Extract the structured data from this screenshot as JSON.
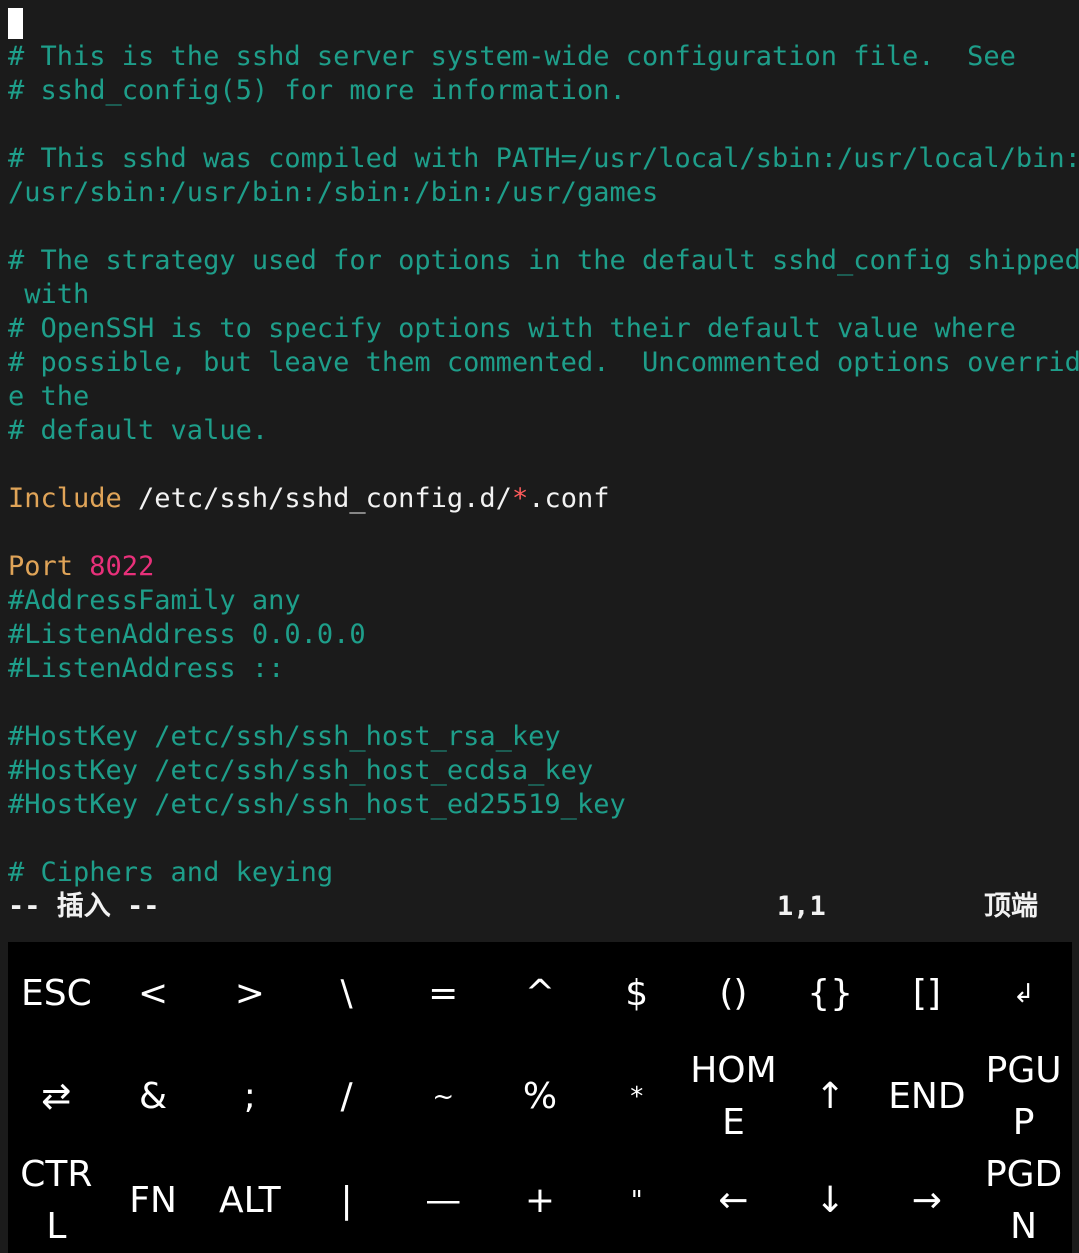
{
  "editor": {
    "lines": [
      [],
      [
        {
          "t": "# This is the sshd server system-wide configuration file.  See",
          "c": "comment"
        }
      ],
      [
        {
          "t": "# sshd_config(5) for more information.",
          "c": "comment"
        }
      ],
      [],
      [
        {
          "t": "# This sshd was compiled with PATH=/usr/local/sbin:/usr/local/bin:",
          "c": "comment"
        }
      ],
      [
        {
          "t": "/usr/sbin:/usr/bin:/sbin:/bin:/usr/games",
          "c": "comment"
        }
      ],
      [],
      [
        {
          "t": "# The strategy used for options in the default sshd_config shipped",
          "c": "comment"
        }
      ],
      [
        {
          "t": " with",
          "c": "comment"
        }
      ],
      [
        {
          "t": "# OpenSSH is to specify options with their default value where",
          "c": "comment"
        }
      ],
      [
        {
          "t": "# possible, but leave them commented.  Uncommented options overrid",
          "c": "comment"
        }
      ],
      [
        {
          "t": "e the",
          "c": "comment"
        }
      ],
      [
        {
          "t": "# default value.",
          "c": "comment"
        }
      ],
      [],
      [
        {
          "t": "Include",
          "c": "keyword"
        },
        {
          "t": " /etc/ssh/sshd_config.d/",
          "c": "text"
        },
        {
          "t": "*",
          "c": "star"
        },
        {
          "t": ".conf",
          "c": "text"
        }
      ],
      [],
      [
        {
          "t": "Port",
          "c": "keyword"
        },
        {
          "t": " ",
          "c": "text"
        },
        {
          "t": "8022",
          "c": "number"
        }
      ],
      [
        {
          "t": "#AddressFamily any",
          "c": "comment"
        }
      ],
      [
        {
          "t": "#ListenAddress 0.0.0.0",
          "c": "comment"
        }
      ],
      [
        {
          "t": "#ListenAddress ::",
          "c": "comment"
        }
      ],
      [],
      [
        {
          "t": "#HostKey /etc/ssh/ssh_host_rsa_key",
          "c": "comment"
        }
      ],
      [
        {
          "t": "#HostKey /etc/ssh/ssh_host_ecdsa_key",
          "c": "comment"
        }
      ],
      [
        {
          "t": "#HostKey /etc/ssh/ssh_host_ed25519_key",
          "c": "comment"
        }
      ],
      [],
      [
        {
          "t": "# Ciphers and keying",
          "c": "comment"
        }
      ]
    ]
  },
  "status_bar": {
    "mode": "-- 插入 --",
    "position": "1,1",
    "scroll": "顶端"
  },
  "extra_keys": {
    "rows": [
      [
        "ESC",
        "<",
        ">",
        "\\",
        "=",
        "^",
        "$",
        "()",
        "{}",
        "[]",
        "↲"
      ],
      [
        "⇄",
        "&",
        ";",
        "/",
        "~",
        "%",
        "*",
        "HOME",
        "↑",
        "END",
        "PGUP"
      ],
      [
        "CTRL",
        "FN",
        "ALT",
        "|",
        "—",
        "+",
        "\"",
        "←",
        "↓",
        "→",
        "PGDN"
      ]
    ]
  },
  "colors": {
    "background": "#1b1b1b",
    "comment": "#1e9e8a",
    "keyword": "#e0a458",
    "number": "#e8307a",
    "keyboard_bg": "#000000"
  }
}
